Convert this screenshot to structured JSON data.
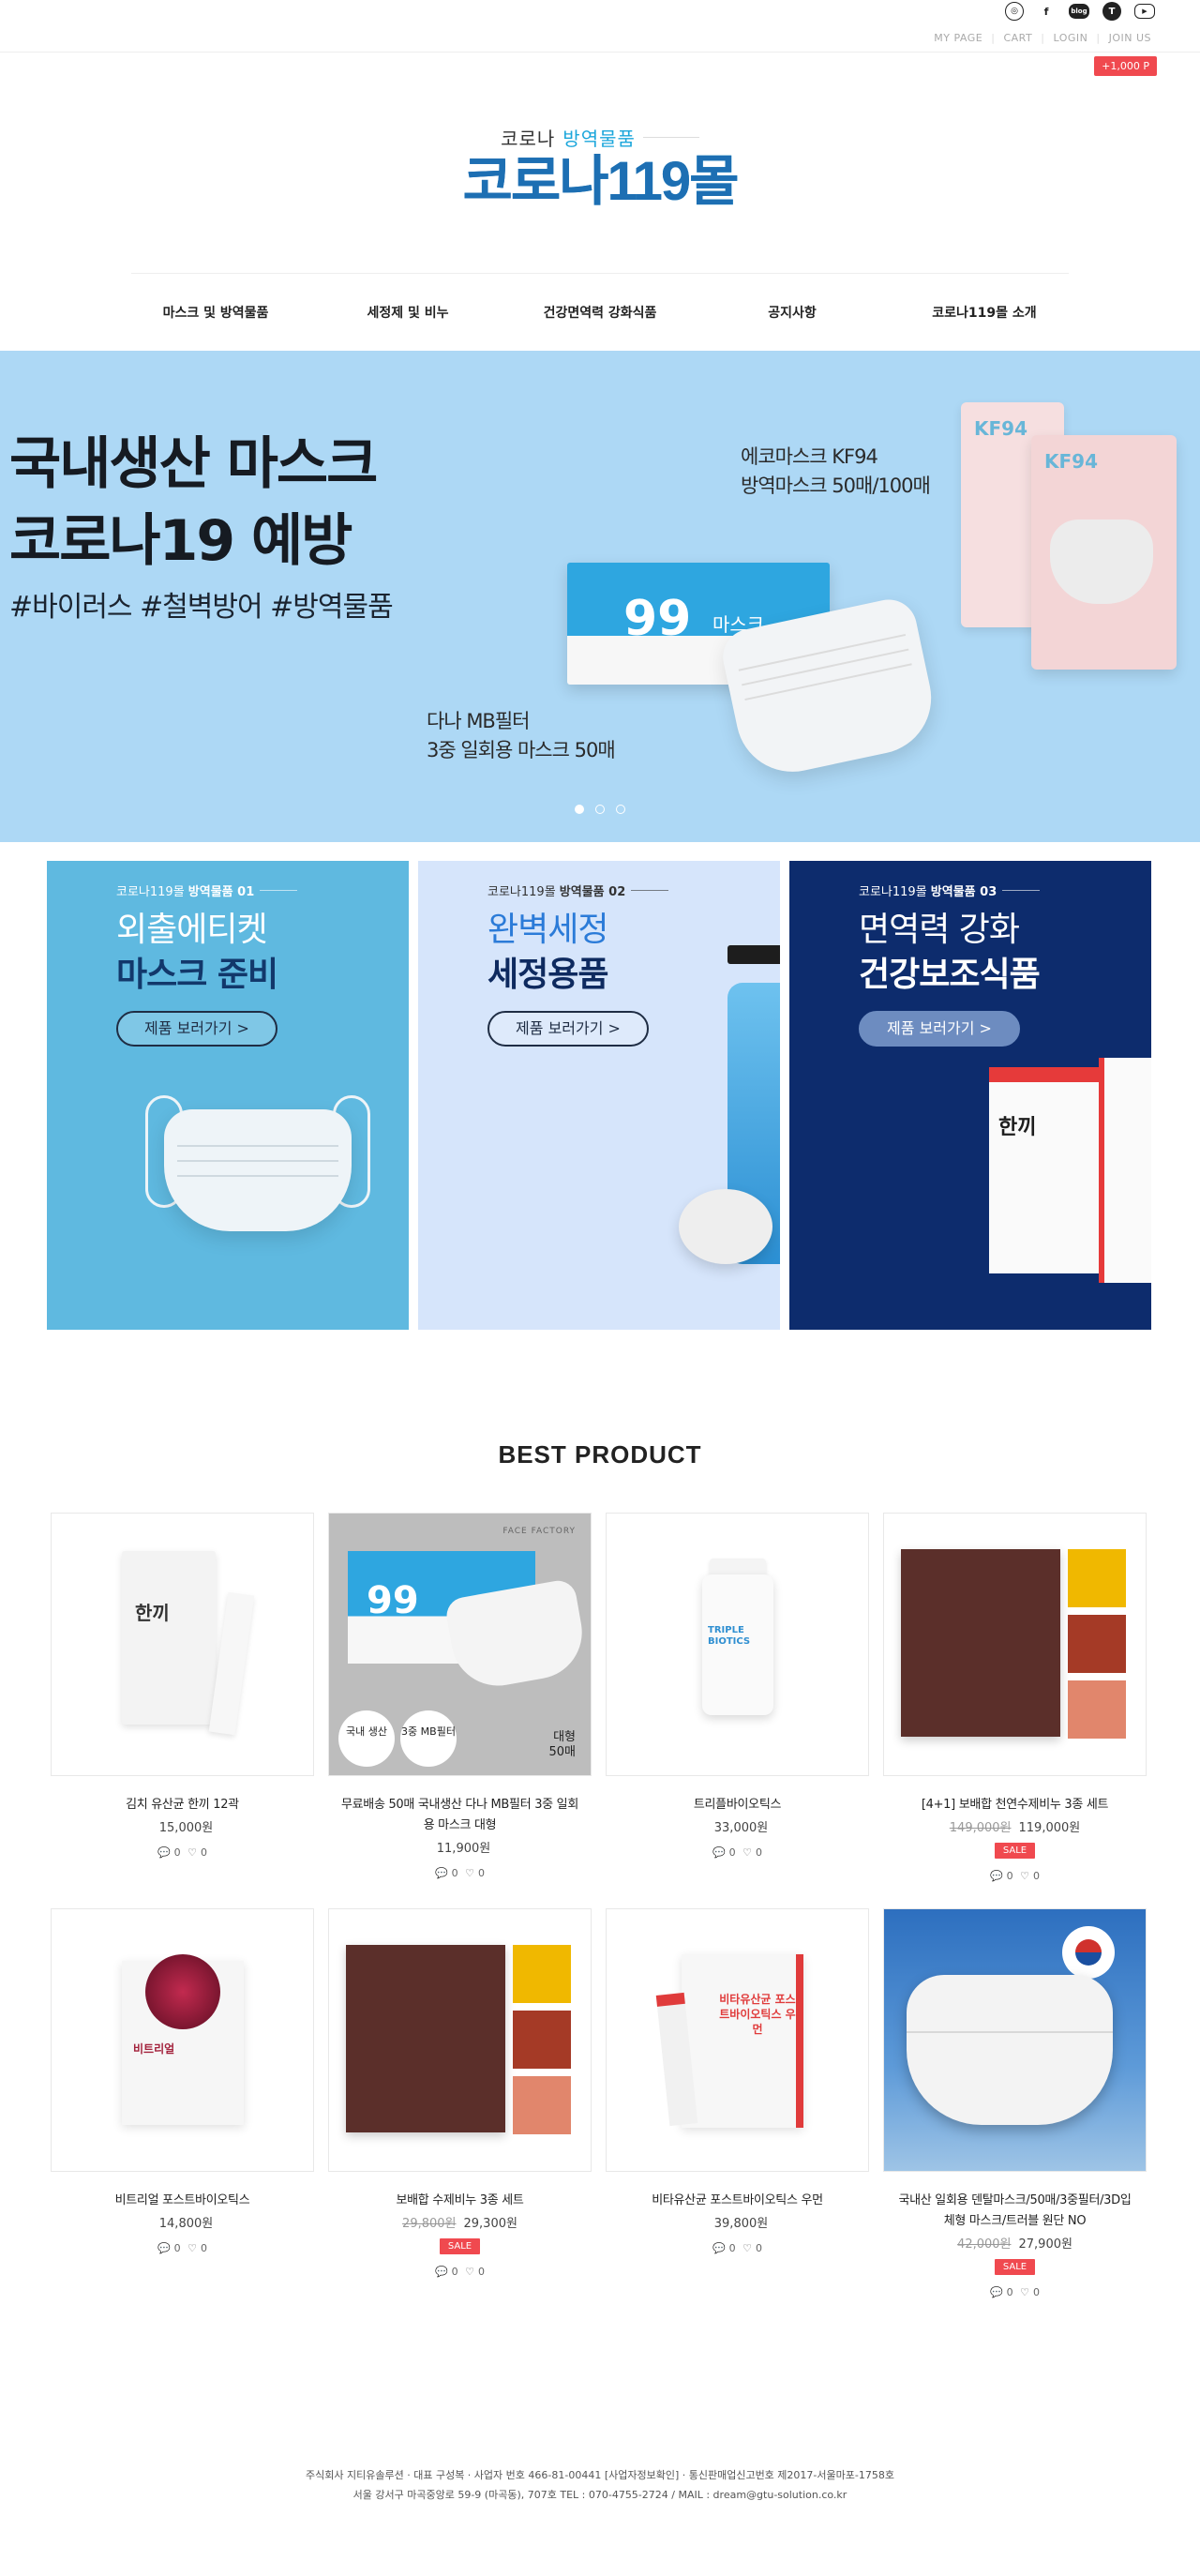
{
  "utility": {
    "mypage": "MY PAGE",
    "cart": "CART",
    "login": "LOGIN",
    "join": "JOIN US",
    "point_badge": "+1,000 P"
  },
  "social": {
    "instagram": "◎",
    "facebook": "f",
    "blog": "blog",
    "tstory": "T",
    "youtube": "▶"
  },
  "logo": {
    "sub_left": "코로나",
    "sub_right": "방역물품",
    "main": "코로나119몰"
  },
  "nav": [
    "마스크 및 방역물품",
    "세정제 및 비누",
    "건강면역력 강화식품",
    "공지사항",
    "코로나119몰 소개"
  ],
  "hero": {
    "title_line1": "국내생산 마스크",
    "title_line2": "코로나19 예방",
    "tags": "#바이러스 #철벽방어 #방역물품",
    "kf_line1": "에코마스크 KF94",
    "kf_line2": "방역마스크 50매/100매",
    "mb_line1": "다나 MB필터",
    "mb_line2": "3중 일회용 마스크 50매",
    "box_number": "99",
    "box_text": "마스크",
    "kf_pack": "KF94"
  },
  "categories": [
    {
      "brand": "코로나119몰",
      "label": "방역물품 01",
      "line1": "외출에티켓",
      "line2": "마스크 준비",
      "button": "제품 보러가기 >"
    },
    {
      "brand": "코로나119몰",
      "label": "방역물품 02",
      "line1": "완벽세정",
      "line2": "세정용품",
      "button": "제품 보러가기 >"
    },
    {
      "brand": "코로나119몰",
      "label": "방역물품 03",
      "line1": "면역력 강화",
      "line2": "건강보조식품",
      "button": "제품 보러가기 >"
    }
  ],
  "best_title": "BEST PRODUCT",
  "products": [
    {
      "name": "김치 유산균 한끼 12곽",
      "price": "15,000원",
      "orig": "",
      "sale": "",
      "comments": "0",
      "likes": "0"
    },
    {
      "name": "무료배송 50매 국내생산 다나 MB필터 3중 일회용 마스크 대형",
      "price": "11,900원",
      "orig": "",
      "sale": "",
      "comments": "0",
      "likes": "0"
    },
    {
      "name": "트리플바이오틱스",
      "price": "33,000원",
      "orig": "",
      "sale": "",
      "comments": "0",
      "likes": "0"
    },
    {
      "name": "[4+1] 보배합 천연수제비누 3종 세트",
      "price": "119,000원",
      "orig": "149,000원",
      "sale": "SALE",
      "comments": "0",
      "likes": "0"
    },
    {
      "name": "비트리얼 포스트바이오틱스",
      "price": "14,800원",
      "orig": "",
      "sale": "",
      "comments": "0",
      "likes": "0"
    },
    {
      "name": "보배합 수제비누 3종 세트",
      "price": "29,300원",
      "orig": "29,800원",
      "sale": "SALE",
      "comments": "0",
      "likes": "0"
    },
    {
      "name": "비타유산균 포스트바이오틱스 우먼",
      "price": "39,800원",
      "orig": "",
      "sale": "",
      "comments": "0",
      "likes": "0"
    },
    {
      "name": "국내산 일회용 덴탈마스크/50매/3중필터/3D입체형 마스크/트러블 원단 NO",
      "price": "27,900원",
      "orig": "42,000원",
      "sale": "SALE",
      "comments": "0",
      "likes": "0"
    }
  ],
  "thumb_text": {
    "kimchi": "한끼",
    "mask_box": "99",
    "mask_c1": "국내 생산",
    "mask_c2": "3중 MB필터",
    "mask_large": "대형",
    "mask_count": "50매",
    "mask_brand": "FACE FACTORY",
    "bottle": "TRIPLE BIOTICS",
    "beet": "비트리얼",
    "vita": "비타유산균 포스트바이오틱스 우먼"
  },
  "footer": {
    "line1": "주식회사 지티유솔루션 · 대표 구성복 · 사업자 번호 466-81-00441 [사업자정보확인] · 통신판매업신고번호 제2017-서울마포-1758호",
    "line2": "서울 강서구 마곡중앙로 59-9 (마곡동), 707호 TEL : 070-4755-2724 / MAIL : dream@gtu-solution.co.kr"
  },
  "colors": {
    "accent_red": "#f0494f",
    "hero_bg": "#add8f5",
    "logo_blue": "#1d6fb3",
    "cat1_bg": "#5fb9e0",
    "cat2_bg": "#d6e5fb",
    "cat3_bg": "#0d2c6d"
  }
}
